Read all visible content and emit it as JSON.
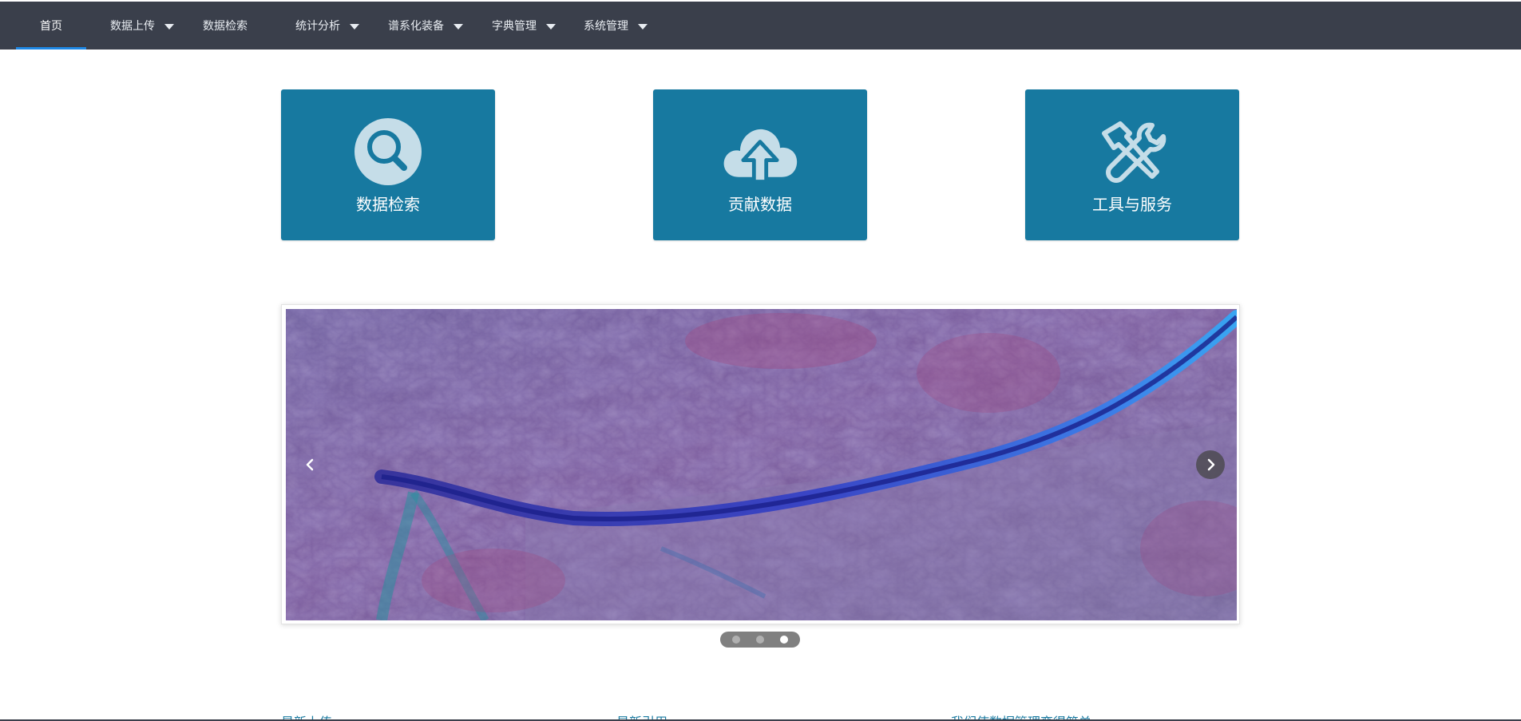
{
  "nav": {
    "items": [
      {
        "label": "首页",
        "has_dropdown": false,
        "active": true
      },
      {
        "label": "数据上传",
        "has_dropdown": true,
        "active": false
      },
      {
        "label": "数据检索",
        "has_dropdown": false,
        "active": false
      },
      {
        "label": "统计分析",
        "has_dropdown": true,
        "active": false
      },
      {
        "label": "谱系化装备",
        "has_dropdown": true,
        "active": false
      },
      {
        "label": "字典管理",
        "has_dropdown": true,
        "active": false
      },
      {
        "label": "系统管理",
        "has_dropdown": true,
        "active": false
      }
    ],
    "colors": {
      "background": "#3a3f4b",
      "active_underline": "#1e88e5"
    }
  },
  "tiles": [
    {
      "label": "数据检索",
      "icon": "search-icon"
    },
    {
      "label": "贡献数据",
      "icon": "cloud-upload-icon"
    },
    {
      "label": "工具与服务",
      "icon": "tools-icon"
    }
  ],
  "tile_color": "#1779a0",
  "carousel": {
    "slide_count": 3,
    "active_index": 2,
    "prev_icon": "chevron-left-icon",
    "next_icon": "chevron-right-icon"
  },
  "sections": [
    {
      "heading": "最新上传"
    },
    {
      "heading": "最新引用"
    },
    {
      "heading": "我们使数据管理变得简单"
    }
  ]
}
